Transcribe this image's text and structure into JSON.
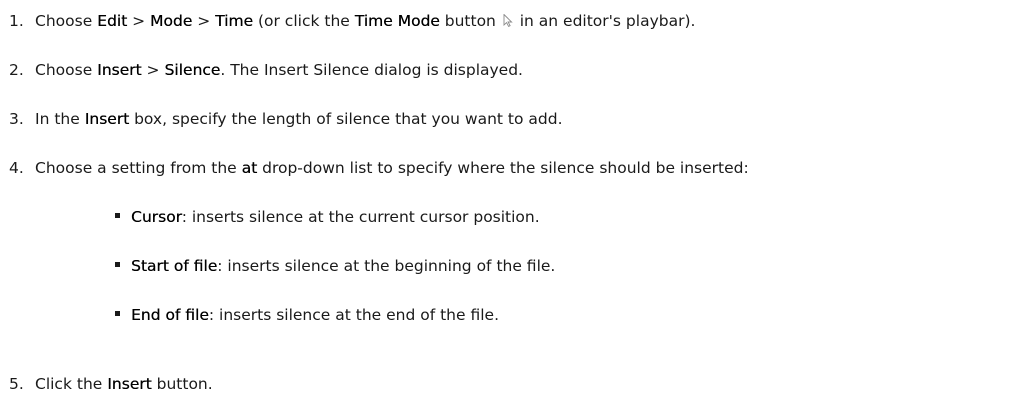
{
  "steps": [
    {
      "number": "1.",
      "segments": {
        "a": "Choose ",
        "b": "Edit",
        "c": " > ",
        "d": "Mode",
        "e": " > ",
        "f": "Time",
        "g": " (or click the ",
        "h": "Time Mode",
        "i": " button ",
        "j": " in an editor's playbar)."
      }
    },
    {
      "number": "2.",
      "segments": {
        "a": "Choose ",
        "b": "Insert",
        "c": " > ",
        "d": "Silence",
        "e": ". The Insert Silence dialog is displayed."
      }
    },
    {
      "number": "3.",
      "segments": {
        "a": "In the ",
        "b": "Insert",
        "c": " box, specify the length of silence that you want to add."
      }
    },
    {
      "number": "4.",
      "segments": {
        "a": "Choose a setting from the ",
        "b": "at",
        "c": " drop-down list to specify where the silence should be inserted:"
      }
    },
    {
      "number": "5.",
      "segments": {
        "a": "Click the ",
        "b": "Insert",
        "c": " button."
      }
    }
  ],
  "bullets": [
    {
      "term": "Cursor",
      "desc": ": inserts silence at the current cursor position."
    },
    {
      "term": "Start of file",
      "desc": ": inserts silence at the beginning of the file."
    },
    {
      "term": "End of file",
      "desc": ": inserts silence at the end of the file."
    }
  ],
  "icons": {
    "time_mode": "arrow-cursor-icon"
  }
}
